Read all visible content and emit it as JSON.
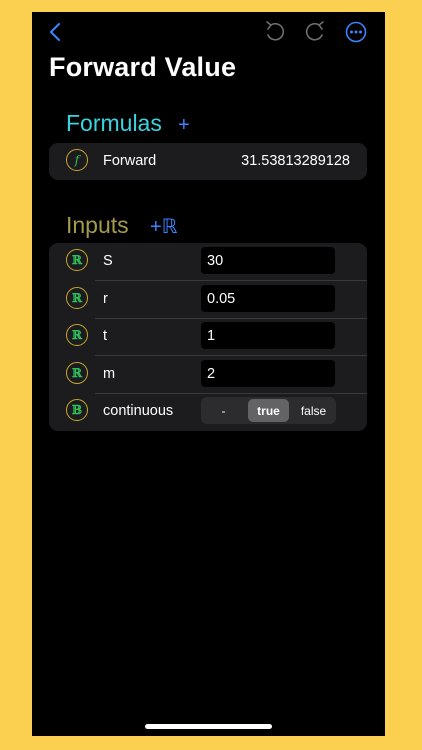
{
  "nav": {
    "back": "back-chevron",
    "undo": "undo-icon",
    "redo": "redo-icon",
    "more": "more-icon"
  },
  "page": {
    "title": "Forward Value"
  },
  "formulas": {
    "heading": "Formulas",
    "add_label": "+",
    "items": [
      {
        "badge": "f",
        "name": "Forward",
        "value": "31.53813289128"
      }
    ]
  },
  "inputs": {
    "heading": "Inputs",
    "add_label": "+ℝ",
    "items": [
      {
        "badge": "ℝ",
        "name": "S",
        "value": "30"
      },
      {
        "badge": "ℝ",
        "name": "r",
        "value": "0.05"
      },
      {
        "badge": "ℝ",
        "name": "t",
        "value": "1"
      },
      {
        "badge": "ℝ",
        "name": "m",
        "value": "2"
      }
    ],
    "boolean": {
      "badge": "𝔹",
      "name": "continuous",
      "options": [
        "-",
        "true",
        "false"
      ],
      "selected": "true"
    }
  },
  "colors": {
    "frame": "#FBCF4F",
    "formulas_heading": "#39D4E0",
    "inputs_heading": "#A59A4B",
    "accent": "#3A84FF"
  }
}
